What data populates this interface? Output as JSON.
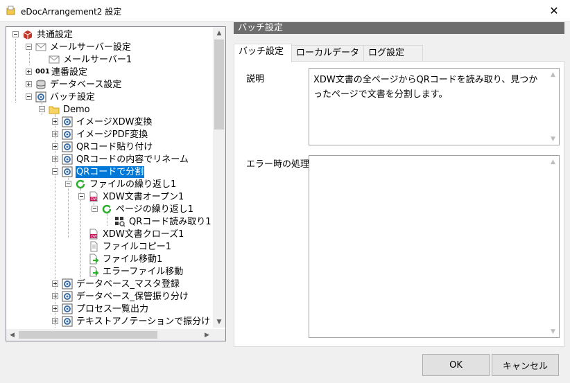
{
  "window": {
    "title": "eDocArrangement2 設定",
    "close_glyph": "✕"
  },
  "tree": {
    "nodes": [
      {
        "label": "共通設定",
        "icon": "box-icon"
      },
      {
        "label": "メールサーバー設定",
        "icon": "mail-icon"
      },
      {
        "label": "メールサーバー1",
        "icon": "mail-icon"
      },
      {
        "label": "連番設定",
        "icon": "numbering-icon",
        "icon_text": "001"
      },
      {
        "label": "データベース設定",
        "icon": "database-icon"
      },
      {
        "label": "バッチ設定",
        "icon": "batch-icon"
      },
      {
        "label": "Demo",
        "icon": "folder-icon"
      },
      {
        "label": "イメージXDW変換",
        "icon": "batch-icon"
      },
      {
        "label": "イメージPDF変換",
        "icon": "batch-icon"
      },
      {
        "label": "QRコード貼り付け",
        "icon": "batch-icon"
      },
      {
        "label": "QRコードの内容でリネーム",
        "icon": "batch-icon"
      },
      {
        "label": "QRコードで分割",
        "icon": "batch-icon",
        "selected": true
      },
      {
        "label": "ファイルの繰り返し1",
        "icon": "loop-icon"
      },
      {
        "label": "XDW文書オープン1",
        "icon": "xdw-icon"
      },
      {
        "label": "ページの繰り返し1",
        "icon": "loop-icon"
      },
      {
        "label": "QRコード読み取り1",
        "icon": "qr-read-icon"
      },
      {
        "label": "XDW文書クローズ1",
        "icon": "xdw-icon"
      },
      {
        "label": "ファイルコピー1",
        "icon": "file-copy-icon"
      },
      {
        "label": "ファイル移動1",
        "icon": "file-move-icon"
      },
      {
        "label": "エラーファイル移動",
        "icon": "file-move-icon"
      },
      {
        "label": "データベース_マスタ登録",
        "icon": "batch-icon"
      },
      {
        "label": "データベース_保管振り分け",
        "icon": "batch-icon"
      },
      {
        "label": "プロセス一覧出力",
        "icon": "batch-icon"
      },
      {
        "label": "テキストアノテーションで振分け",
        "icon": "batch-icon"
      }
    ]
  },
  "panel": {
    "header": "バッチ設定",
    "tabs": [
      {
        "label": "バッチ設定",
        "active": true
      },
      {
        "label": "ローカルデータ",
        "active": false
      },
      {
        "label": "ログ設定",
        "active": false
      }
    ],
    "description_label": "説明",
    "description_value": "XDW文書の全ページからQRコードを読み取り、見つかったページで文書を分割します。",
    "error_label": "エラー時の処理",
    "error_value": ""
  },
  "buttons": {
    "ok": "OK",
    "cancel": "キャンセル"
  },
  "colors": {
    "selection": "#0078d7",
    "header_bg": "#6d6d6d",
    "window_bg": "#f0f0f0"
  }
}
